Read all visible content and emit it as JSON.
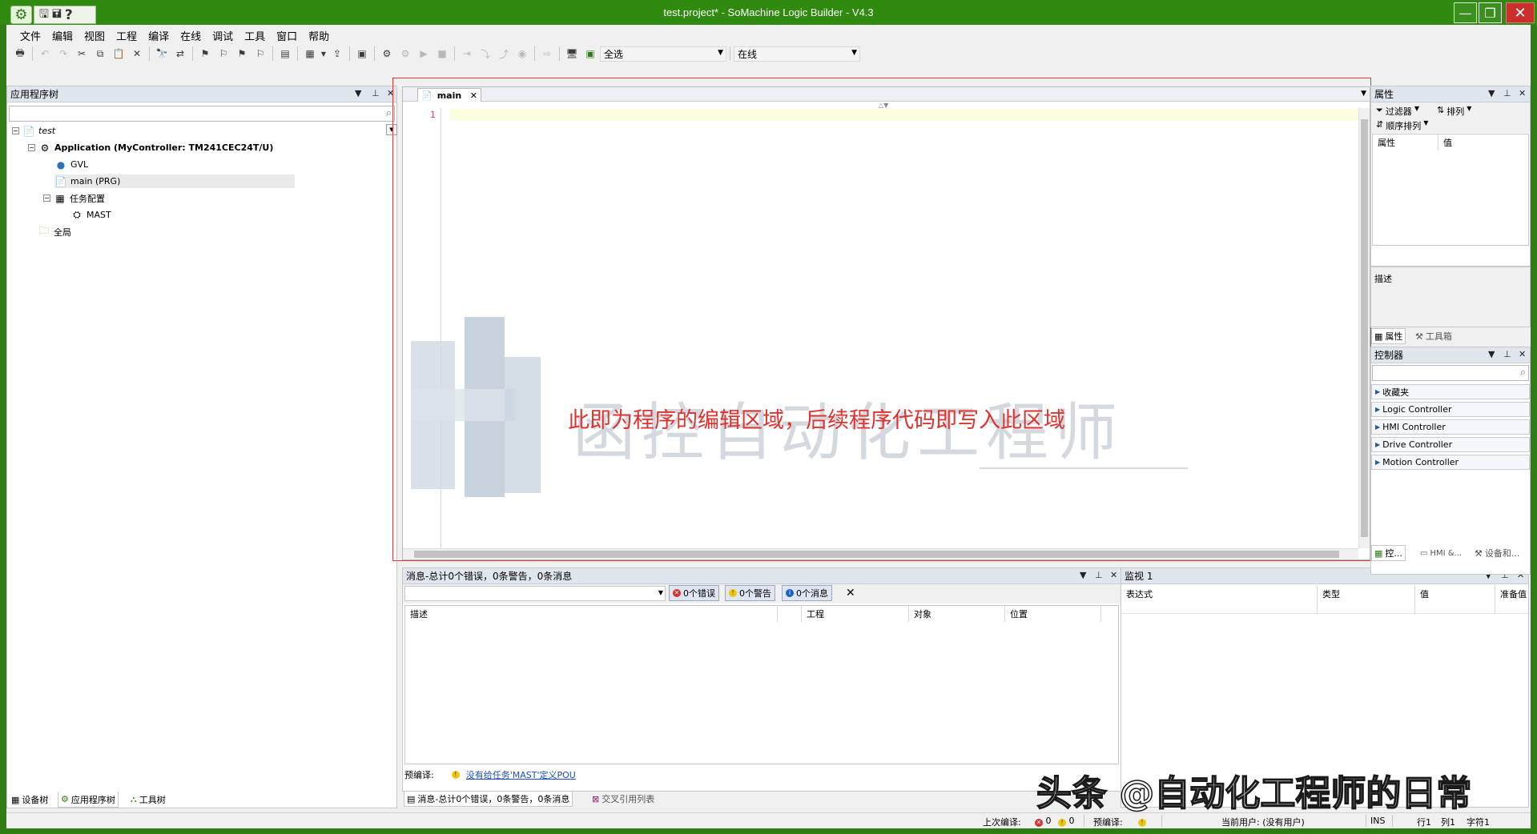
{
  "window": {
    "title": "test.project* - SoMachine Logic Builder - V4.3",
    "qa_icons": [
      "save-icon",
      "save-all-icon",
      "help-icon"
    ],
    "min_glyph": "—",
    "max_glyph": "❐",
    "close_glyph": "✕"
  },
  "menu": [
    "文件",
    "编辑",
    "视图",
    "工程",
    "编译",
    "在线",
    "调试",
    "工具",
    "窗口",
    "帮助"
  ],
  "toolbar": {
    "combo_select": "全选",
    "combo_online": "在线"
  },
  "app_tree": {
    "title": "应用程序树",
    "nodes": {
      "test": "test",
      "application": "Application (MyController: TM241CEC24T/U)",
      "gvl": "GVL",
      "main": "main (PRG)",
      "task_config": "任务配置",
      "mast": "MAST",
      "global": "全局"
    },
    "tabs": [
      "设备树",
      "应用程序树",
      "工具树"
    ]
  },
  "editor": {
    "tab_label": "main",
    "line_numbers": [
      "1"
    ]
  },
  "annotation": "此即为程序的编辑区域，后续程序代码即写入此区域",
  "watermark_text": "函控自动化工程师",
  "messages": {
    "title": "消息-总计0个错误，0条警告，0条消息",
    "filter_errors": "0个错误",
    "filter_warnings": "0个警告",
    "filter_messages": "0个消息",
    "columns": [
      "描述",
      "工程",
      "对象",
      "位置"
    ],
    "precompile_label": "预编译:",
    "precompile_link": "没有给任务'MAST'定义POU",
    "tabs": [
      "消息-总计0个错误，0条警告，0条消息",
      "交叉引用列表"
    ]
  },
  "watch": {
    "title": "监视 1",
    "columns": [
      "表达式",
      "类型",
      "值",
      "准备值"
    ]
  },
  "properties": {
    "title": "属性",
    "filter_label": "过滤器",
    "sort_label": "排列",
    "order_label": "顺序排列",
    "col_property": "属性",
    "col_value": "值",
    "description_label": "描述",
    "tabs": [
      "属性",
      "工具箱"
    ]
  },
  "controller": {
    "title": "控制器",
    "items": [
      "收藏夹",
      "Logic Controller",
      "HMI Controller",
      "Drive Controller",
      "Motion Controller"
    ],
    "tabs": [
      "控...",
      "HMI &...",
      "设备和..."
    ]
  },
  "status": {
    "last_compile_label": "上次编译:",
    "err_count": "0",
    "warn_count": "0",
    "precompile_label": "预编译:",
    "current_user": "当前用户: (没有用户)",
    "ins": "INS",
    "row": "行1",
    "col": "列1",
    "char": "字符1"
  },
  "brand_overlay": "头条 @自动化工程师的日常",
  "colors": {
    "title_bar": "#2f8a0f",
    "annotation_red": "#e0332f",
    "pane_header": "#dfe6ee"
  }
}
